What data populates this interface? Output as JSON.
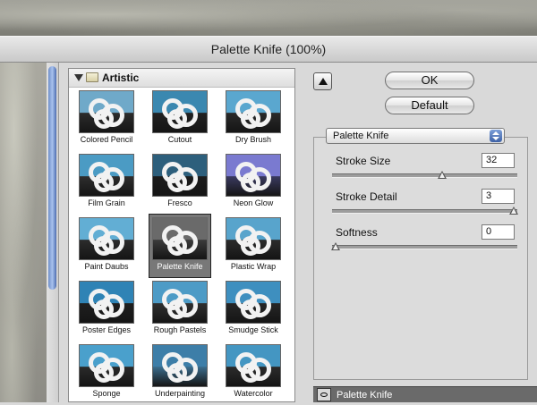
{
  "window": {
    "title": "Palette Knife (100%)"
  },
  "gallery": {
    "category": "Artistic",
    "filters": [
      {
        "name": "Colored Pencil"
      },
      {
        "name": "Cutout"
      },
      {
        "name": "Dry Brush"
      },
      {
        "name": "Film Grain"
      },
      {
        "name": "Fresco"
      },
      {
        "name": "Neon Glow"
      },
      {
        "name": "Paint Daubs"
      },
      {
        "name": "Palette Knife",
        "selected": true
      },
      {
        "name": "Plastic Wrap"
      },
      {
        "name": "Poster Edges"
      },
      {
        "name": "Rough Pastels"
      },
      {
        "name": "Smudge Stick"
      },
      {
        "name": "Sponge"
      },
      {
        "name": "Underpainting"
      },
      {
        "name": "Watercolor"
      }
    ]
  },
  "buttons": {
    "ok": "OK",
    "default": "Default"
  },
  "settings": {
    "selected_filter": "Palette Knife",
    "params": [
      {
        "label": "Stroke Size",
        "value": "32",
        "fraction": 0.6
      },
      {
        "label": "Stroke Detail",
        "value": "3",
        "fraction": 1.0
      },
      {
        "label": "Softness",
        "value": "0",
        "fraction": 0.0
      }
    ]
  },
  "layers": {
    "active": "Palette Knife"
  },
  "colors": {
    "selection_bg": "#787878",
    "accent_blue": "#3f62a6"
  }
}
